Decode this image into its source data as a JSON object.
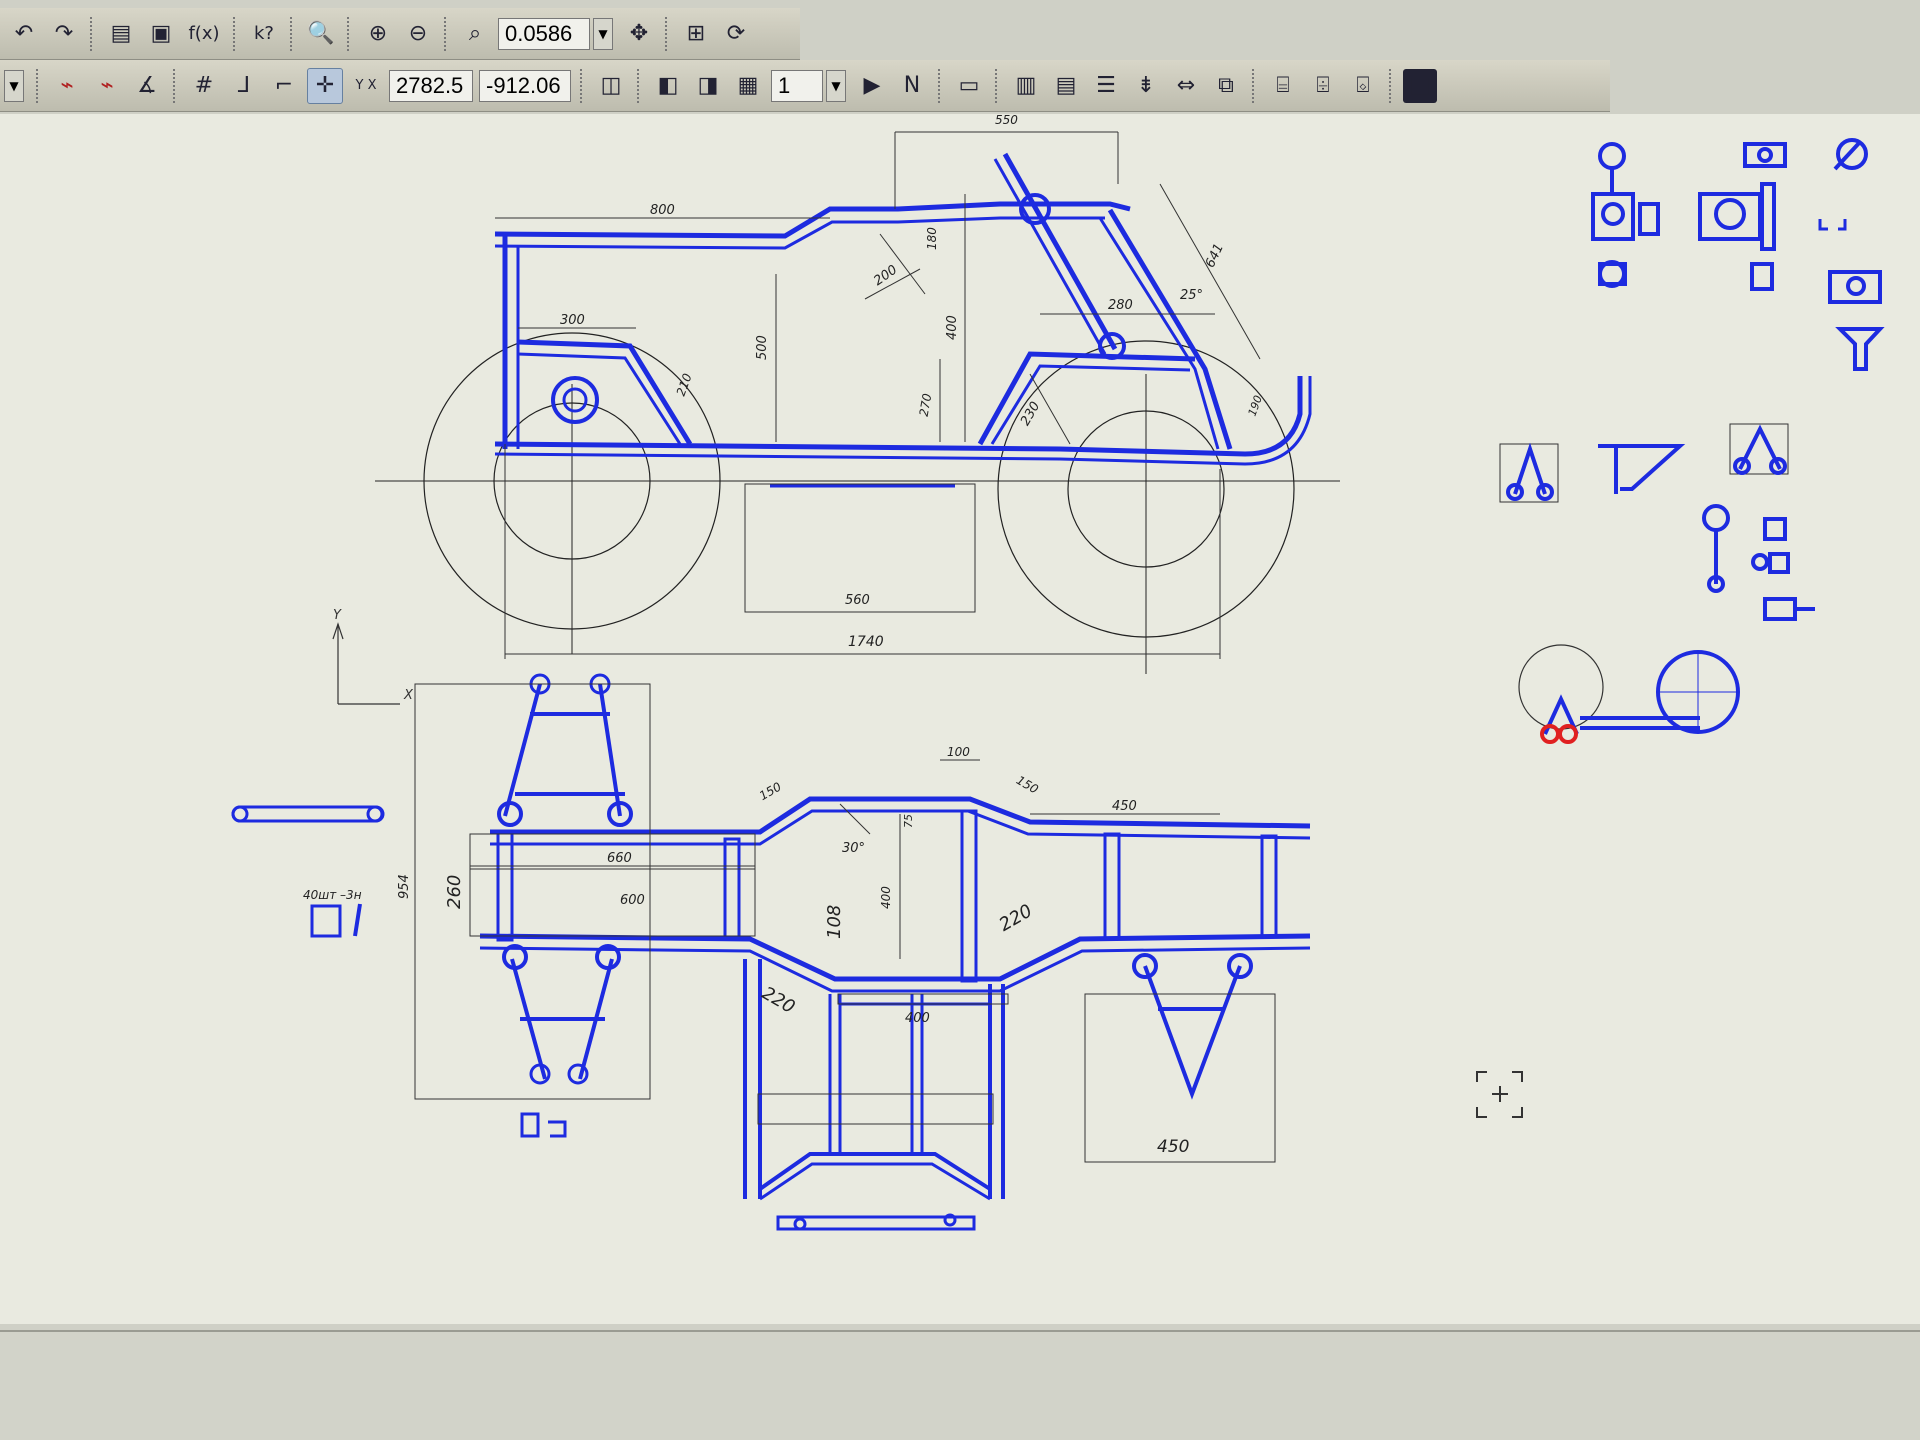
{
  "toolbar_top": {
    "formula_label": "f(x)",
    "help_label": "k?",
    "zoom_value": "0.0586"
  },
  "toolbar_bottom": {
    "coord_x": "2782.5",
    "coord_y": "-912.06",
    "xy_label": "Y X",
    "layer_value": "1"
  },
  "drawing": {
    "side_view": {
      "dim_800": "800",
      "dim_550": "550",
      "dim_300": "300",
      "dim_500": "500",
      "dim_400": "400",
      "dim_180": "180",
      "dim_200": "200",
      "dim_280": "280",
      "dim_210": "210",
      "dim_230": "230",
      "dim_641": "641",
      "dim_25": "25°",
      "dim_190": "190",
      "dim_270": "270",
      "dim_560": "560",
      "dim_1740": "1740"
    },
    "plan_view": {
      "dim_260": "260",
      "dim_954": "954",
      "dim_660": "660",
      "dim_600": "600",
      "dim_150a": "150",
      "dim_30": "30°",
      "dim_100": "100",
      "dim_75": "75",
      "dim_150b": "150",
      "dim_450a": "450",
      "dim_108": "108",
      "dim_400": "400",
      "dim_220a": "220",
      "dim_220b": "220",
      "dim_450b": "450",
      "note": "40шт –3н"
    },
    "axis": {
      "y": "Y",
      "x": "X"
    }
  }
}
